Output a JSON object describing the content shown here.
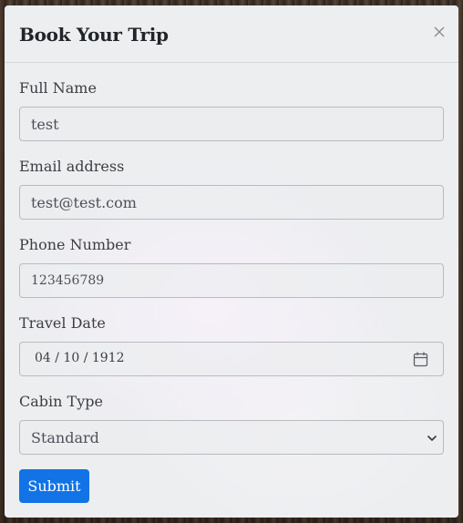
{
  "modal": {
    "title": "Book Your Trip",
    "close_label": "×"
  },
  "form": {
    "full_name": {
      "label": "Full Name",
      "value": "test"
    },
    "email": {
      "label": "Email address",
      "value": "test@test.com"
    },
    "phone": {
      "label": "Phone Number",
      "value": "123456789"
    },
    "travel_date": {
      "label": "Travel Date",
      "value": "04 / 10 / 1912"
    },
    "cabin_type": {
      "label": "Cabin Type",
      "value": "Standard"
    },
    "submit_label": "Submit"
  },
  "icons": {
    "close": "close-icon",
    "calendar": "calendar-icon",
    "dropdown": "chevron-down-icon"
  },
  "colors": {
    "primary": "#1273e6",
    "modal_bg": "#eceef0",
    "border": "#b7bcc1"
  }
}
